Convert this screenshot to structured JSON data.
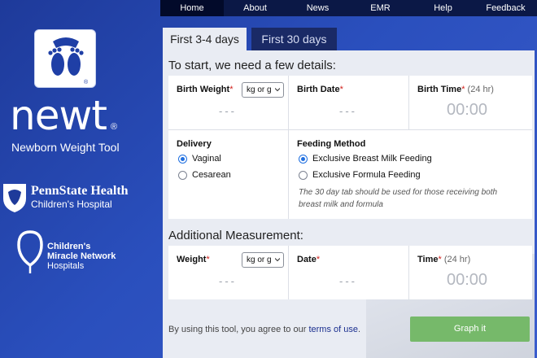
{
  "brand": {
    "logo_icon": "baby-feet-icon",
    "name": "newt",
    "registered": "®",
    "tagline": "Newborn Weight Tool",
    "sponsor1": {
      "title": "PennState Health",
      "subtitle": "Children's Hospital",
      "icon": "nittany-lion-shield-icon"
    },
    "sponsor2": {
      "line1": "Children's",
      "line2": "Miracle Network",
      "line3": "Hospitals",
      "icon": "balloon-icon"
    }
  },
  "nav": {
    "items": [
      {
        "label": "Home",
        "active": true
      },
      {
        "label": "About",
        "active": false
      },
      {
        "label": "News",
        "active": false
      },
      {
        "label": "EMR",
        "active": false
      },
      {
        "label": "Help",
        "active": false
      },
      {
        "label": "Feedback",
        "active": false
      }
    ]
  },
  "tabs": [
    {
      "label": "First 3-4 days",
      "active": true
    },
    {
      "label": "First 30 days",
      "active": false
    }
  ],
  "form": {
    "intro": "To start, we need a few details:",
    "birth_weight": {
      "label": "Birth Weight",
      "req": "*",
      "unit": "kg or g",
      "value": "---"
    },
    "birth_date": {
      "label": "Birth Date",
      "req": "*",
      "value": "---"
    },
    "birth_time": {
      "label": "Birth Time",
      "req": "*",
      "hint": "(24 hr)",
      "value": "00:00"
    },
    "delivery": {
      "label": "Delivery",
      "options": [
        {
          "label": "Vaginal",
          "selected": true
        },
        {
          "label": "Cesarean",
          "selected": false
        }
      ]
    },
    "feeding": {
      "label": "Feeding Method",
      "options": [
        {
          "label": "Exclusive Breast Milk Feeding",
          "selected": true
        },
        {
          "label": "Exclusive Formula Feeding",
          "selected": false
        }
      ],
      "note": "The 30 day tab should be used for those receiving both breast milk and formula"
    },
    "additional": "Additional Measurement:",
    "weight": {
      "label": "Weight",
      "req": "*",
      "unit": "kg or g",
      "value": "---"
    },
    "date": {
      "label": "Date",
      "req": "*",
      "value": "---"
    },
    "time": {
      "label": "Time",
      "req": "*",
      "hint": "(24 hr)",
      "value": "00:00"
    },
    "terms_prefix": "By using this tool, you agree to our ",
    "terms_link": "terms of use",
    "terms_suffix": ".",
    "graph_button": "Graph it"
  },
  "colors": {
    "accent_green": "#76b96a",
    "nav_bg": "#0b1846",
    "required": "#d0211c",
    "radio": "#1f6fe0"
  }
}
